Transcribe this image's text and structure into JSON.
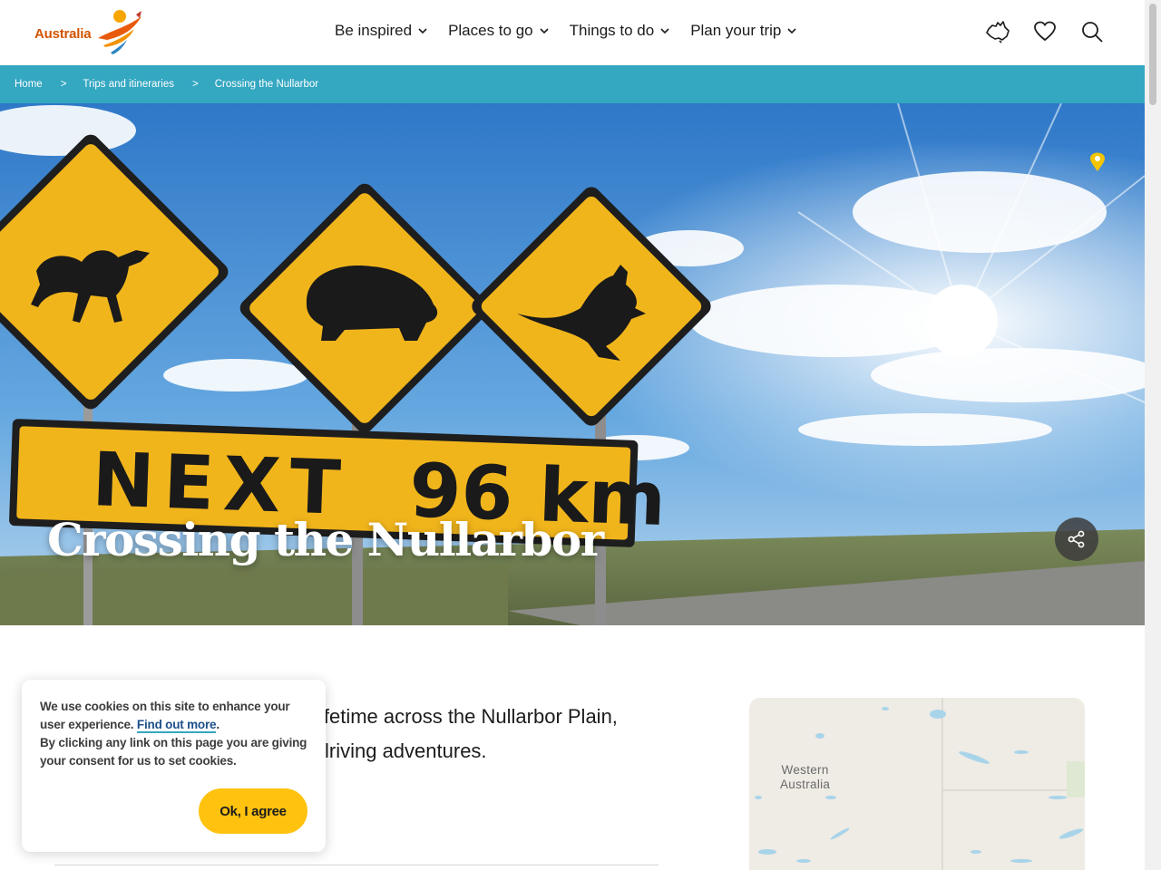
{
  "header": {
    "logo_text": "Australia",
    "nav": [
      {
        "label": "Be inspired"
      },
      {
        "label": "Places to go"
      },
      {
        "label": "Things to do"
      },
      {
        "label": "Plan your trip"
      }
    ],
    "icons": [
      "australia-map-icon",
      "heart-icon",
      "search-icon"
    ]
  },
  "breadcrumb": {
    "items": [
      "Home",
      "Trips and itineraries",
      "Crossing the Nullarbor"
    ],
    "separator": ">"
  },
  "hero": {
    "title": "Crossing the Nullarbor",
    "sign_text": "NEXT 96 km",
    "sign_next": "NEXT",
    "sign_distance": "96 km",
    "share_icon": "share-icon",
    "pin_icon": "location-pin-icon"
  },
  "intro": {
    "line1": "ifetime across the Nullarbor Plain,",
    "line2": "lriving adventures."
  },
  "map": {
    "label_line1": "Western",
    "label_line2": "Australia"
  },
  "cookie": {
    "text_before": "We use cookies on this site to enhance your user experience. ",
    "link": "Find out more",
    "text_after": ".",
    "text_consent": "By clicking any link on this page you are giving your consent for us to set cookies.",
    "button": "Ok, I agree"
  },
  "colors": {
    "brand_orange": "#d35400",
    "breadcrumb_bg": "#34a7c1",
    "button_yellow": "#ffc20e",
    "sign_yellow": "#f1b51c"
  }
}
